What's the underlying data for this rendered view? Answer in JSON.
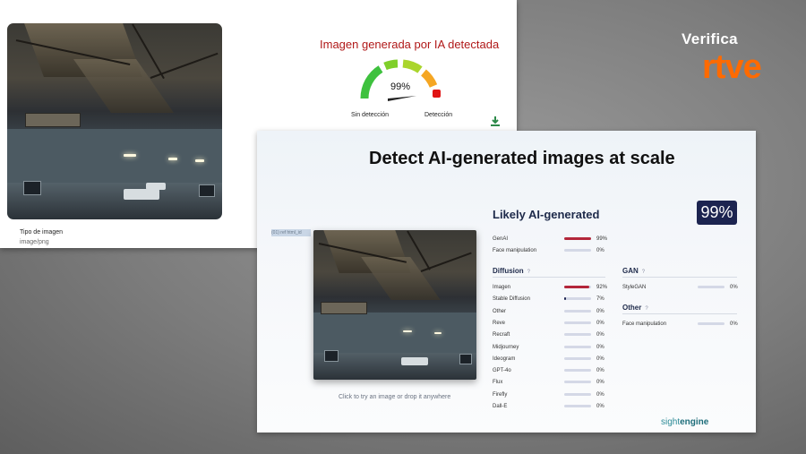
{
  "back_card": {
    "gauge_title": "Imagen generada por IA detectada",
    "gauge_value": "99%",
    "gauge_fraction": 0.99,
    "gauge_left_label": "Sin detección",
    "gauge_right_label": "Detección",
    "image_type_label": "Tipo de imagen",
    "image_type_value": "image/png",
    "download_icon": "download-icon"
  },
  "front_card": {
    "headline": "Detect AI-generated images at scale",
    "selection_text": "(01) ref html_id",
    "caption": "Click to try an image or drop it anywhere",
    "result_title": "Likely AI-generated",
    "result_score": "99%",
    "summary": [
      {
        "label": "GenAI",
        "value": "99%",
        "fraction": 0.99
      },
      {
        "label": "Face manipulation",
        "value": "0%",
        "fraction": 0
      }
    ],
    "diffusion": {
      "title": "Diffusion",
      "help": "?",
      "rows": [
        {
          "label": "Imagen",
          "value": "92%",
          "fraction": 0.92
        },
        {
          "label": "Stable Diffusion",
          "value": "7%",
          "fraction": 0.07
        },
        {
          "label": "Other",
          "value": "0%",
          "fraction": 0
        },
        {
          "label": "Reve",
          "value": "0%",
          "fraction": 0
        },
        {
          "label": "Recraft",
          "value": "0%",
          "fraction": 0
        },
        {
          "label": "Midjourney",
          "value": "0%",
          "fraction": 0
        },
        {
          "label": "Ideogram",
          "value": "0%",
          "fraction": 0
        },
        {
          "label": "GPT-4o",
          "value": "0%",
          "fraction": 0
        },
        {
          "label": "Flux",
          "value": "0%",
          "fraction": 0
        },
        {
          "label": "Firefly",
          "value": "0%",
          "fraction": 0
        },
        {
          "label": "Dall-E",
          "value": "0%",
          "fraction": 0
        }
      ]
    },
    "gan": {
      "title": "GAN",
      "help": "?",
      "rows": [
        {
          "label": "StyleGAN",
          "value": "0%",
          "fraction": 0
        }
      ]
    },
    "other": {
      "title": "Other",
      "help": "?",
      "rows": [
        {
          "label": "Face manipulation",
          "value": "0%",
          "fraction": 0
        }
      ]
    },
    "brand_a": "sight",
    "brand_b": "engine"
  },
  "logo": {
    "verifica": "Verifica",
    "rtve": "rtve"
  },
  "colors": {
    "gauge_title": "#b01818",
    "bar_fill": "#b3263a",
    "bar_fill_low": "#1c2450",
    "badge": "#1c2450",
    "rtve_orange": "#ff6a00"
  }
}
